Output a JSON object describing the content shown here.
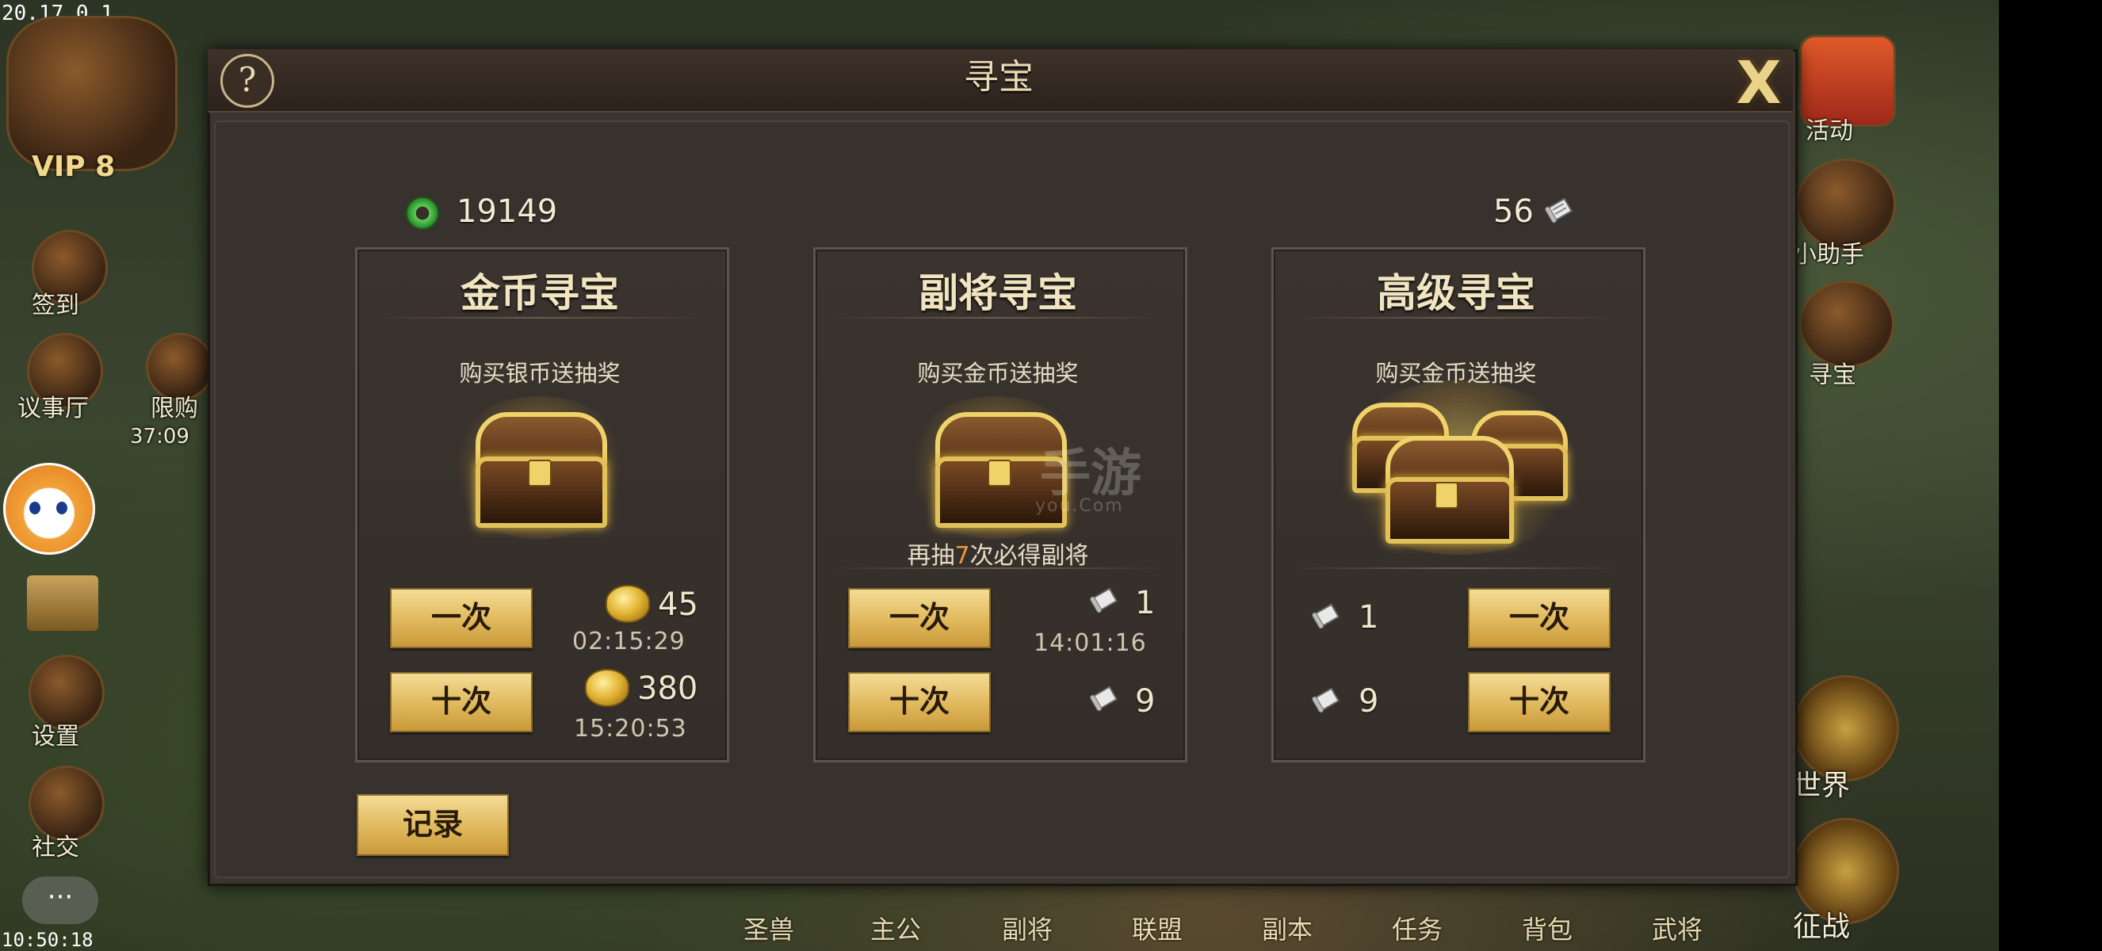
{
  "status": {
    "version": "20.17.0.1",
    "clock": "10:50:18"
  },
  "background": {
    "vip_label": "VIP 8",
    "left_menu": [
      {
        "label": "签到",
        "icon": "sign-in-icon"
      },
      {
        "label": "议事厅",
        "icon": "council-hall-icon"
      },
      {
        "label": "限购",
        "icon": "limited-purchase-icon"
      },
      {
        "label": "设置",
        "icon": "settings-gear-icon"
      },
      {
        "label": "社交",
        "icon": "social-icon"
      }
    ],
    "limited_timer": "37:09",
    "right_menu": [
      {
        "label": "活动",
        "icon": "gift-box-icon"
      },
      {
        "label": "小助手",
        "icon": "assistant-scroll-icon"
      },
      {
        "label": "寻宝",
        "icon": "treasure-chest-icon"
      },
      {
        "label": "世界",
        "icon": "world-dragon-icon"
      },
      {
        "label": "征战",
        "icon": "campaign-dragon-icon"
      }
    ],
    "bottom_nav": [
      "圣兽",
      "主公",
      "副将",
      "联盟",
      "副本",
      "任务",
      "背包",
      "武将"
    ]
  },
  "dialog": {
    "title": "寻宝",
    "help_symbol": "?",
    "close_symbol": "X",
    "jade_amount": "19149",
    "scroll_amount": "56",
    "record_button": "记录",
    "watermark": "手游",
    "watermark_sub": "you.Com"
  },
  "cards": [
    {
      "title": "金币寻宝",
      "subtitle": "购买银币送抽奖",
      "once_label": "一次",
      "ten_label": "十次",
      "once_cost": "45",
      "once_timer": "02:15:29",
      "ten_cost": "380",
      "ten_timer": "15:20:53"
    },
    {
      "title": "副将寻宝",
      "subtitle": "购买金币送抽奖",
      "pity_prefix": "再抽",
      "pity_count": "7",
      "pity_suffix": "次必得副将",
      "once_label": "一次",
      "ten_label": "十次",
      "once_cost": "1",
      "once_timer": "14:01:16",
      "ten_cost": "9"
    },
    {
      "title": "高级寻宝",
      "subtitle": "购买金币送抽奖",
      "once_label": "一次",
      "ten_label": "十次",
      "once_cost": "1",
      "ten_cost": "9"
    }
  ]
}
